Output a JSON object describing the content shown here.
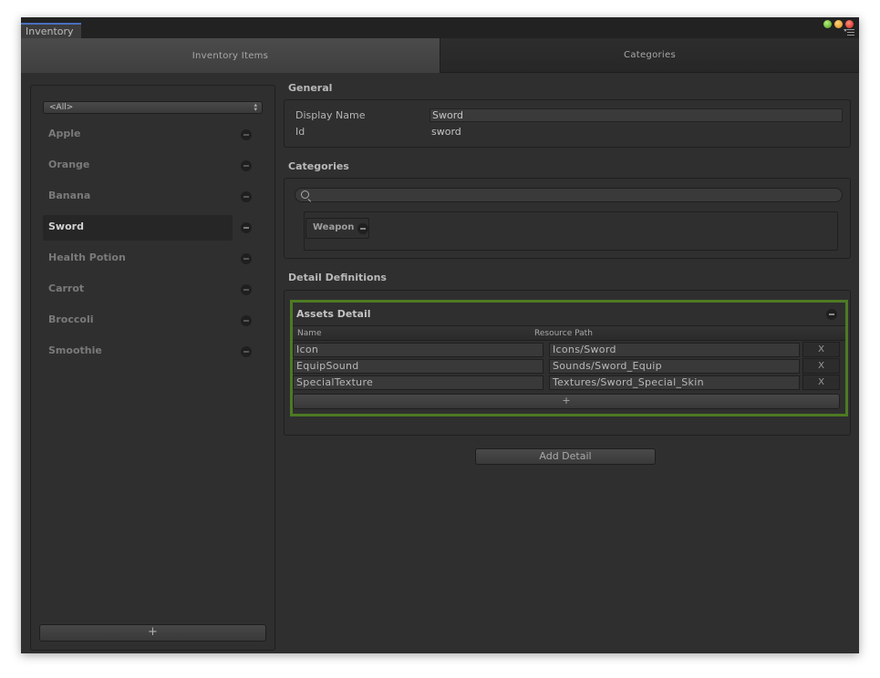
{
  "window": {
    "tab_title": "Inventory",
    "controls": [
      "minimize-green",
      "zoom-yellow",
      "close-red"
    ]
  },
  "top_tabs": [
    {
      "label": "Inventory Items",
      "active": true
    },
    {
      "label": "Categories",
      "active": false
    }
  ],
  "sidebar": {
    "filter_value": "<All>",
    "items": [
      {
        "label": "Apple",
        "selected": false
      },
      {
        "label": "Orange",
        "selected": false
      },
      {
        "label": "Banana",
        "selected": false
      },
      {
        "label": "Sword",
        "selected": true
      },
      {
        "label": "Health Potion",
        "selected": false
      },
      {
        "label": "Carrot",
        "selected": false
      },
      {
        "label": "Broccoli",
        "selected": false
      },
      {
        "label": "Smoothie",
        "selected": false
      }
    ],
    "add_label": "+"
  },
  "general": {
    "title": "General",
    "display_name_label": "Display Name",
    "display_name_value": "Sword",
    "id_label": "Id",
    "id_value": "sword"
  },
  "categories": {
    "title": "Categories",
    "search_value": "",
    "chips": [
      {
        "label": "Weapon"
      }
    ]
  },
  "details": {
    "title": "Detail Definitions",
    "assets": {
      "title": "Assets Detail",
      "columns": [
        "Name",
        "Resource Path"
      ],
      "rows": [
        {
          "name": "Icon",
          "path": "Icons/Sword",
          "remove": "X"
        },
        {
          "name": "EquipSound",
          "path": "Sounds/Sword_Equip",
          "remove": "X"
        },
        {
          "name": "SpecialTexture",
          "path": "Textures/Sword_Special_Skin",
          "remove": "X"
        }
      ],
      "add_row_label": "+",
      "frame_color": "#4d7a24"
    },
    "add_detail_label": "Add Detail"
  }
}
